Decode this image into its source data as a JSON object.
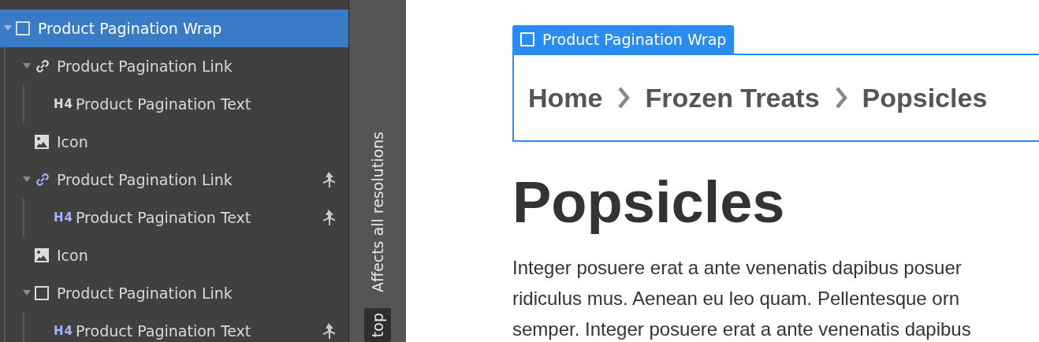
{
  "navigator": {
    "items": [
      {
        "label": "Product Pagination Wrap",
        "kind": "box",
        "selected": true,
        "expanded": true,
        "symbol": false,
        "children": [
          {
            "label": "Product Pagination Link",
            "kind": "link",
            "selected": false,
            "expanded": true,
            "symbol": false,
            "children": [
              {
                "label": "Product Pagination Text",
                "kind": "heading",
                "icon_text": "H4",
                "selected": false,
                "symbol": false
              }
            ]
          },
          {
            "label": "Icon",
            "kind": "image",
            "selected": false,
            "symbol": false
          },
          {
            "label": "Product Pagination Link",
            "kind": "link",
            "selected": false,
            "expanded": true,
            "symbol": true,
            "children": [
              {
                "label": "Product Pagination Text",
                "kind": "heading",
                "icon_text": "H4",
                "selected": false,
                "symbol": true
              }
            ]
          },
          {
            "label": "Icon",
            "kind": "image",
            "selected": false,
            "symbol": false
          },
          {
            "label": "Product Pagination Link",
            "kind": "box",
            "selected": false,
            "expanded": true,
            "symbol": false,
            "children": [
              {
                "label": "Product Pagination Text",
                "kind": "heading",
                "icon_text": "H4",
                "selected": false,
                "symbol": true
              }
            ]
          }
        ]
      }
    ]
  },
  "side_strip": {
    "note": "Affects all resolutions",
    "breakpoint": "top"
  },
  "canvas": {
    "selection_label": "Product Pagination Wrap",
    "breadcrumbs": [
      "Home",
      "Frozen Treats",
      "Popsicles"
    ],
    "heading": "Popsicles",
    "paragraph_lines": [
      "Integer posuere erat a ante venenatis dapibus posuer",
      "ridiculus mus. Aenean eu leo quam. Pellentesque orn",
      "semper. Integer posuere erat a ante venenatis dapibus"
    ]
  }
}
